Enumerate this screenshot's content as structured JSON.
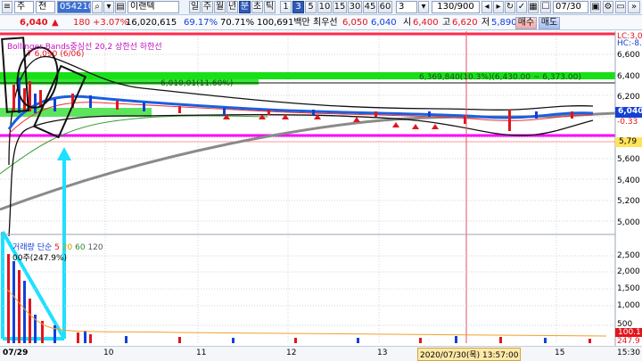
{
  "toolbar": {
    "tab_stock": "주",
    "tab_prev": "전",
    "code": "054210",
    "name": "이랜텍",
    "period_buttons": [
      "일",
      "주",
      "월",
      "년",
      "분",
      "초",
      "틱"
    ],
    "minute_buttons": [
      "1",
      "3",
      "5",
      "10",
      "15",
      "30",
      "45",
      "60"
    ],
    "count_value": "3",
    "range_value": "130/900",
    "date_value": "07/30"
  },
  "quote": {
    "price": "6,040",
    "change_arrow": "▲",
    "change": "180",
    "change_rate": "+3.07%",
    "volume": "16,020,615",
    "rate1": "69.17%",
    "rate2": "70.71%",
    "amount": "100,691백만",
    "best_ask_label": "최우선",
    "best_ask": "6,050",
    "best_bid": "6,040",
    "open_label": "시",
    "open": "6,400",
    "high_label": "고",
    "high": "6,620",
    "low_label": "저",
    "low": "5,890",
    "buy_button": "매수",
    "sell_button": "매도"
  },
  "legend": {
    "bb_text": "Bollinger Bands중심선 20,2 상한선 하한선",
    "lc_label": "LC:3,0",
    "hc_label": "HC:-8.",
    "price_note": "6,369,840(10.3%)(6,430.00 ~ 6,373.00)",
    "bar_label": "6,010,01(11.60%)",
    "small_label": "7 6,090 (6/06)"
  },
  "price_axis": [
    "6,600",
    "6,400",
    "6,200",
    "6,040",
    "-0.33",
    "5,79",
    "5,600",
    "5,400",
    "5,200",
    "5,000"
  ],
  "volume_legend": {
    "label": "거래량",
    "ma_label": "단순",
    "ma1": "5",
    "ma2": "20",
    "ma3": "60",
    "ma4": "120",
    "value": "00주(247.9%)"
  },
  "volume_axis": [
    "2,500",
    "2,000",
    "1,500",
    "1,000",
    "500",
    "100.1",
    "247.9"
  ],
  "dates": [
    "07/29",
    "10",
    "11",
    "12",
    "13",
    "14",
    "15",
    "15:30"
  ],
  "crosshair_label": "2020/07/30(목) 13:57:00",
  "colors": {
    "up": "#e2151d",
    "down": "#1340d6",
    "magenta": "#ff00ff",
    "cyan": "#1ee0ff",
    "green": "#00e000",
    "crosshair": "#e0506a"
  }
}
